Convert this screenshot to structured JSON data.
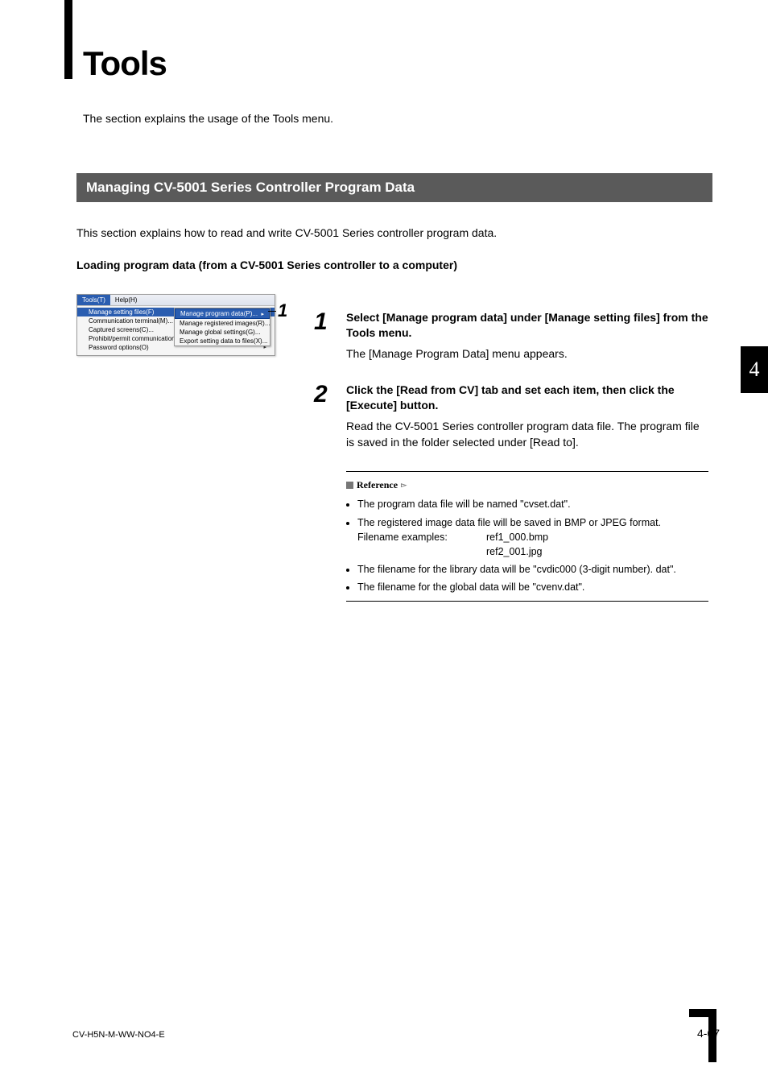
{
  "title": "Tools",
  "intro": "The section explains the usage of the Tools menu.",
  "section_heading": "Managing CV-5001 Series Controller Program Data",
  "section_desc": "This section explains how to read and write CV-5001 Series controller program data.",
  "subheading": "Loading program data (from a CV-5001 Series controller to a computer)",
  "menu": {
    "menubar": {
      "tools": "Tools(T)",
      "help": "Help(H)"
    },
    "items": [
      "Manage setting files(F)",
      "Communication terminal(M)...",
      "Captured screens(C)...",
      "Prohibit/permit communication(P)...",
      "Password options(O)"
    ],
    "items_arrow_last": true,
    "submenu": [
      "Manage program data(P)...",
      "Manage registered images(R)...",
      "Manage global settings(G)...",
      "Export setting data to files(X)..."
    ]
  },
  "callout_num": "1",
  "steps": [
    {
      "num": "1",
      "instr": "Select [Manage program data] under [Manage setting files] from the Tools menu.",
      "result": "The [Manage Program Data] menu appears."
    },
    {
      "num": "2",
      "instr": "Click the [Read from CV] tab and set each item, then click the [Execute] button.",
      "result": "Read the CV-5001 Series controller program data file. The program file is saved in the folder selected under [Read to]."
    }
  ],
  "reference": {
    "label": "Reference",
    "bullets": [
      "The program data file will be named \"cvset.dat\".",
      "The registered image data file will be saved in BMP or JPEG format.",
      "The filename for the library data will be \"cvdic000 (3-digit number). dat\".",
      "The filename for the global data will be \"cvenv.dat\"."
    ],
    "filename_label": "Filename examples:",
    "filename_ex": [
      "ref1_000.bmp",
      "ref2_001.jpg"
    ]
  },
  "side_tab": "4",
  "footer": {
    "left": "CV-H5N-M-WW-NO4-E",
    "right": "4-67"
  }
}
